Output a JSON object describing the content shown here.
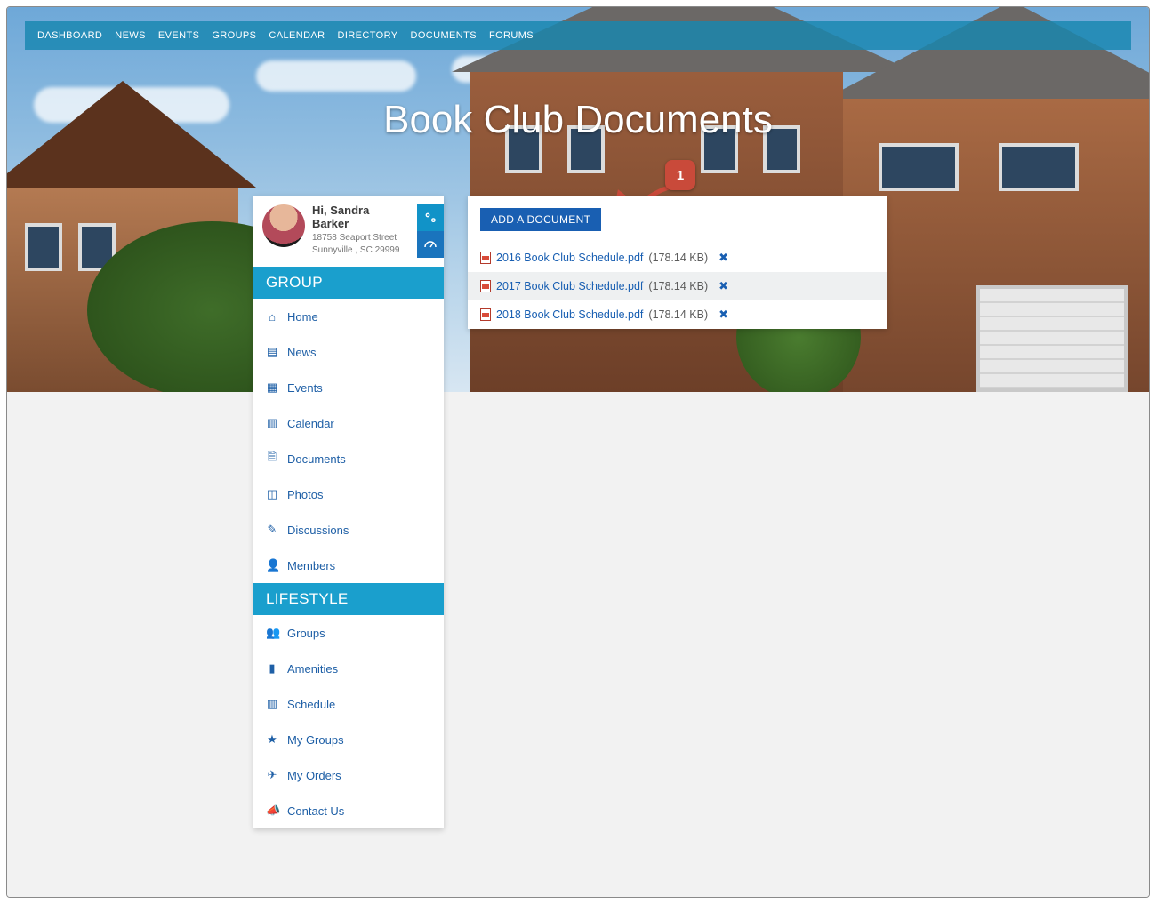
{
  "topnav": [
    "DASHBOARD",
    "NEWS",
    "EVENTS",
    "GROUPS",
    "CALENDAR",
    "DIRECTORY",
    "DOCUMENTS",
    "FORUMS"
  ],
  "page_title": "Book Club Documents",
  "callout": {
    "number": "1"
  },
  "profile": {
    "greeting": "Hi, Sandra Barker",
    "address1": "18758 Seaport Street",
    "address2": "Sunnyville , SC 29999"
  },
  "sidebar": {
    "sections": [
      {
        "title": "GROUP",
        "items": [
          {
            "icon": "home-icon",
            "glyph": "⌂",
            "label": "Home"
          },
          {
            "icon": "news-icon",
            "glyph": "▤",
            "label": "News"
          },
          {
            "icon": "events-icon",
            "glyph": "▦",
            "label": "Events"
          },
          {
            "icon": "calendar-icon",
            "glyph": "▥",
            "label": "Calendar"
          },
          {
            "icon": "documents-icon",
            "glyph": "🗎",
            "label": "Documents"
          },
          {
            "icon": "photos-icon",
            "glyph": "◫",
            "label": "Photos"
          },
          {
            "icon": "discussions-icon",
            "glyph": "✎",
            "label": "Discussions"
          },
          {
            "icon": "members-icon",
            "glyph": "👤",
            "label": "Members"
          }
        ]
      },
      {
        "title": "LIFESTYLE",
        "items": [
          {
            "icon": "groups-icon",
            "glyph": "👥",
            "label": "Groups"
          },
          {
            "icon": "amenities-icon",
            "glyph": "▮",
            "label": "Amenities"
          },
          {
            "icon": "schedule-icon",
            "glyph": "▥",
            "label": "Schedule"
          },
          {
            "icon": "my-groups-icon",
            "glyph": "★",
            "label": "My Groups"
          },
          {
            "icon": "my-orders-icon",
            "glyph": "✈",
            "label": "My Orders"
          },
          {
            "icon": "contact-icon",
            "glyph": "📣",
            "label": "Contact Us"
          }
        ]
      }
    ]
  },
  "documents": {
    "add_label": "ADD A DOCUMENT",
    "rows": [
      {
        "name": "2016 Book Club Schedule.pdf",
        "size": "(178.14 KB)"
      },
      {
        "name": "2017 Book Club Schedule.pdf",
        "size": "(178.14 KB)"
      },
      {
        "name": "2018 Book Club Schedule.pdf",
        "size": "(178.14 KB)"
      }
    ]
  }
}
